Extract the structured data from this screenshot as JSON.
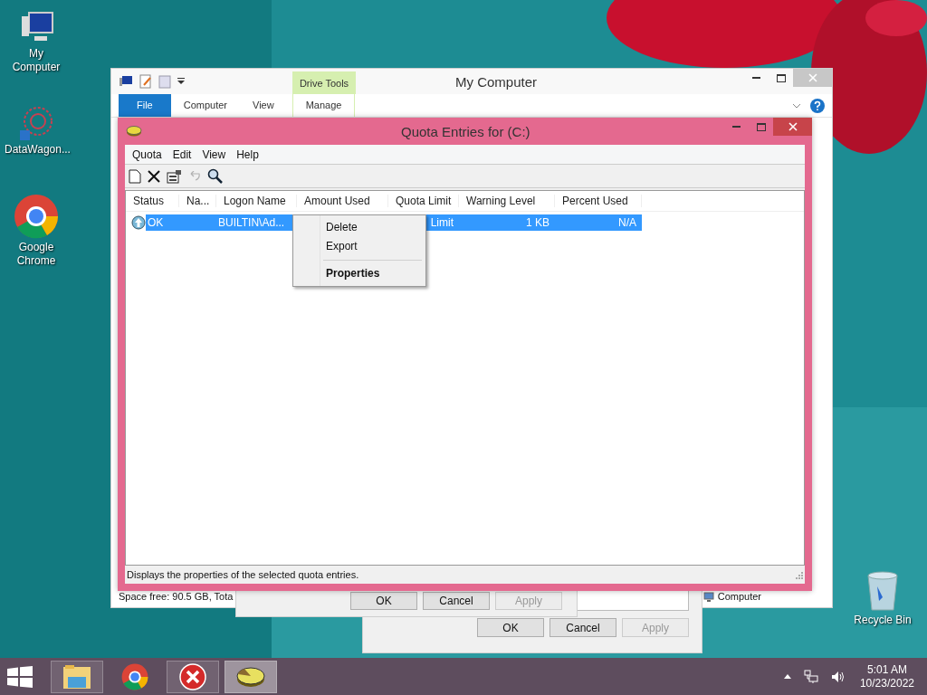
{
  "desktop_icons": [
    {
      "kind": "computer",
      "label": "My Computer"
    },
    {
      "kind": "network",
      "label": "DataWagon..."
    },
    {
      "kind": "chrome",
      "label": "Google Chrome"
    },
    {
      "kind": "bin",
      "label": "Recycle Bin"
    }
  ],
  "explorer": {
    "title": "My Computer",
    "contextual_tab": "Drive Tools",
    "tabs": [
      {
        "label": "File",
        "selected": true
      },
      {
        "label": "Computer",
        "selected": false
      },
      {
        "label": "View",
        "selected": false
      },
      {
        "label": "Manage",
        "selected": false
      }
    ],
    "status_left": "Space free: 90.5 GB, Tota",
    "status_right": "Computer"
  },
  "back_dialog": {
    "buttons": [
      {
        "label": "OK",
        "disabled": false
      },
      {
        "label": "Cancel",
        "disabled": false
      },
      {
        "label": "Apply",
        "disabled": true
      }
    ]
  },
  "front_dialog": {
    "buttons": [
      {
        "label": "OK",
        "disabled": false
      },
      {
        "label": "Cancel",
        "disabled": false
      },
      {
        "label": "Apply",
        "disabled": true
      }
    ]
  },
  "quota": {
    "title": "Quota Entries for  (C:)",
    "menu": [
      "Quota",
      "Edit",
      "View",
      "Help"
    ],
    "toolbar": [
      {
        "kind": "new",
        "disabled": false
      },
      {
        "kind": "delete",
        "disabled": false
      },
      {
        "kind": "properties",
        "disabled": false
      },
      {
        "kind": "undo",
        "disabled": true
      },
      {
        "kind": "find",
        "disabled": false
      }
    ],
    "columns": [
      "Status",
      "Na...",
      "Logon Name",
      "Amount Used",
      "Quota Limit",
      "Warning Level",
      "Percent Used"
    ],
    "rows": [
      {
        "status": "OK",
        "logon_name": "BUILTIN\\Ad...",
        "quota_limit": "Limit",
        "warning_level": "1 KB",
        "percent_used": "N/A",
        "selected": true
      }
    ],
    "status_bar": "Displays the properties of the selected quota entries."
  },
  "context_menu": [
    {
      "kind": "item",
      "label": "Delete",
      "default": false
    },
    {
      "kind": "item",
      "label": "Export",
      "default": false
    },
    {
      "kind": "separator"
    },
    {
      "kind": "item",
      "label": "Properties",
      "default": true
    }
  ],
  "taskbar": {
    "apps": [
      {
        "kind": "explorer",
        "active": false
      },
      {
        "kind": "chrome",
        "active": false
      },
      {
        "kind": "error",
        "active": false
      },
      {
        "kind": "quota",
        "active": true
      }
    ],
    "time": "5:01 AM",
    "date": "10/23/2022"
  }
}
